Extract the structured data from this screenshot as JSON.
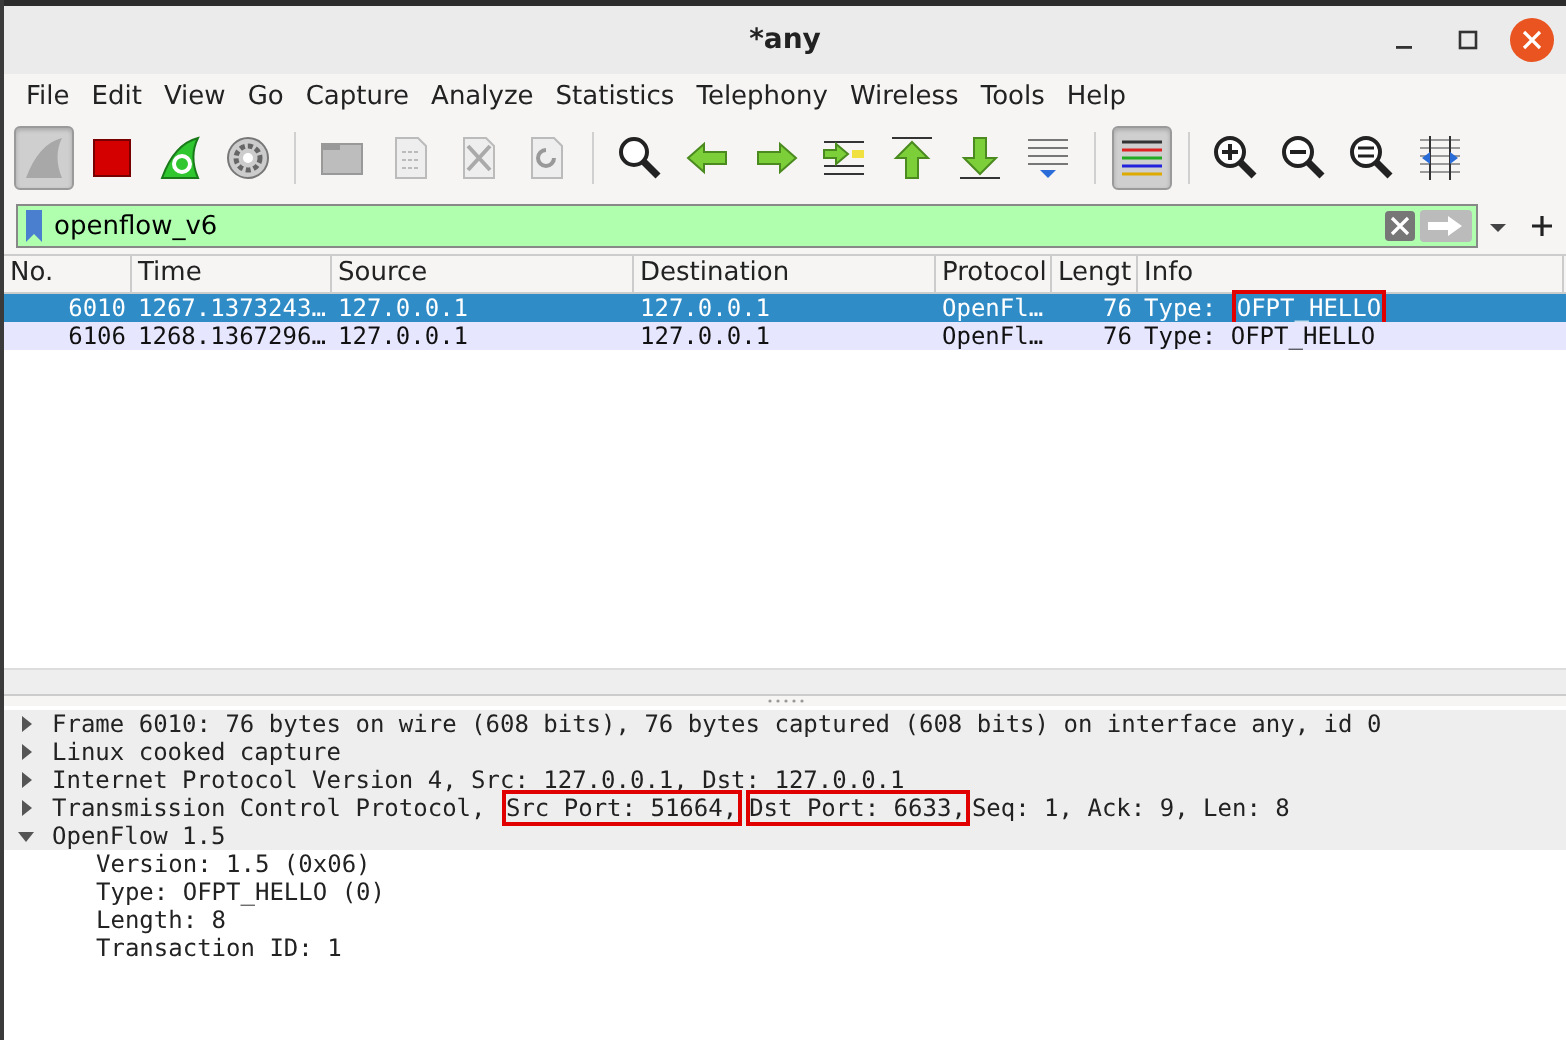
{
  "window": {
    "title": "*any"
  },
  "menu": [
    "File",
    "Edit",
    "View",
    "Go",
    "Capture",
    "Analyze",
    "Statistics",
    "Telephony",
    "Wireless",
    "Tools",
    "Help"
  ],
  "toolbar": [
    {
      "kind": "shark",
      "pressed": true
    },
    {
      "kind": "stop",
      "pressed": false
    },
    {
      "kind": "restart",
      "pressed": false
    },
    {
      "kind": "options",
      "pressed": false
    },
    {
      "kind": "separator"
    },
    {
      "kind": "open",
      "pressed": false
    },
    {
      "kind": "save",
      "pressed": false
    },
    {
      "kind": "close",
      "pressed": false
    },
    {
      "kind": "reload",
      "pressed": false
    },
    {
      "kind": "separator"
    },
    {
      "kind": "find",
      "pressed": false
    },
    {
      "kind": "back",
      "pressed": false
    },
    {
      "kind": "forward",
      "pressed": false
    },
    {
      "kind": "goto",
      "pressed": false
    },
    {
      "kind": "first",
      "pressed": false
    },
    {
      "kind": "last",
      "pressed": false
    },
    {
      "kind": "autoscroll",
      "pressed": false
    },
    {
      "kind": "separator"
    },
    {
      "kind": "colorize",
      "pressed": true
    },
    {
      "kind": "separator"
    },
    {
      "kind": "zoom-in",
      "pressed": false
    },
    {
      "kind": "zoom-out",
      "pressed": false
    },
    {
      "kind": "zoom-normal",
      "pressed": false
    },
    {
      "kind": "resize",
      "pressed": false
    }
  ],
  "filter": {
    "value": "openflow_v6"
  },
  "packet_list": {
    "columns": [
      "No.",
      "Time",
      "Source",
      "Destination",
      "Protocol",
      "Lengt",
      "Info"
    ],
    "rows": [
      {
        "selected": true,
        "cells": [
          "6010",
          "1267.1373243…",
          "127.0.0.1",
          "127.0.0.1",
          "OpenFl…",
          "76"
        ],
        "info": [
          {
            "text": "Type: ",
            "boxed": false
          },
          {
            "text": "OFPT_HELLO",
            "boxed": true
          }
        ]
      },
      {
        "selected": false,
        "cells": [
          "6106",
          "1268.1367296…",
          "127.0.0.1",
          "127.0.0.1",
          "OpenFl…",
          "76"
        ],
        "info": [
          {
            "text": "Type: ",
            "boxed": false
          },
          {
            "text": "OFPT_HELLO",
            "boxed": false
          }
        ]
      }
    ]
  },
  "details": [
    {
      "expanded": false,
      "parts": [
        {
          "text": "Frame 6010: 76 bytes on wire (608 bits), 76 bytes captured (608 bits) on interface any, id 0",
          "boxed": false
        }
      ]
    },
    {
      "expanded": false,
      "parts": [
        {
          "text": "Linux cooked capture",
          "boxed": false
        }
      ]
    },
    {
      "expanded": false,
      "parts": [
        {
          "text": "Internet Protocol Version 4, Src: 127.0.0.1, Dst: 127.0.0.1",
          "boxed": false
        }
      ]
    },
    {
      "expanded": false,
      "parts": [
        {
          "text": "Transmission Control Protocol, ",
          "boxed": false
        },
        {
          "text": "Src Port: 51664,",
          "boxed": true
        },
        {
          "text": "Dst Port: 6633,",
          "boxed": true
        },
        {
          "text": "Seq: 1, Ack: 9, Len: 8",
          "boxed": false
        }
      ]
    },
    {
      "expanded": true,
      "parts": [
        {
          "text": "OpenFlow 1.5",
          "boxed": false
        }
      ],
      "children": [
        {
          "parts": [
            {
              "text": "Version: 1.5 (0x06)",
              "boxed": false
            }
          ]
        },
        {
          "parts": [
            {
              "text": "Type: OFPT_HELLO (0)",
              "boxed": false
            }
          ]
        },
        {
          "parts": [
            {
              "text": "Length: 8",
              "boxed": false
            }
          ]
        },
        {
          "parts": [
            {
              "text": "Transaction ID: 1",
              "boxed": false
            }
          ]
        }
      ]
    }
  ]
}
